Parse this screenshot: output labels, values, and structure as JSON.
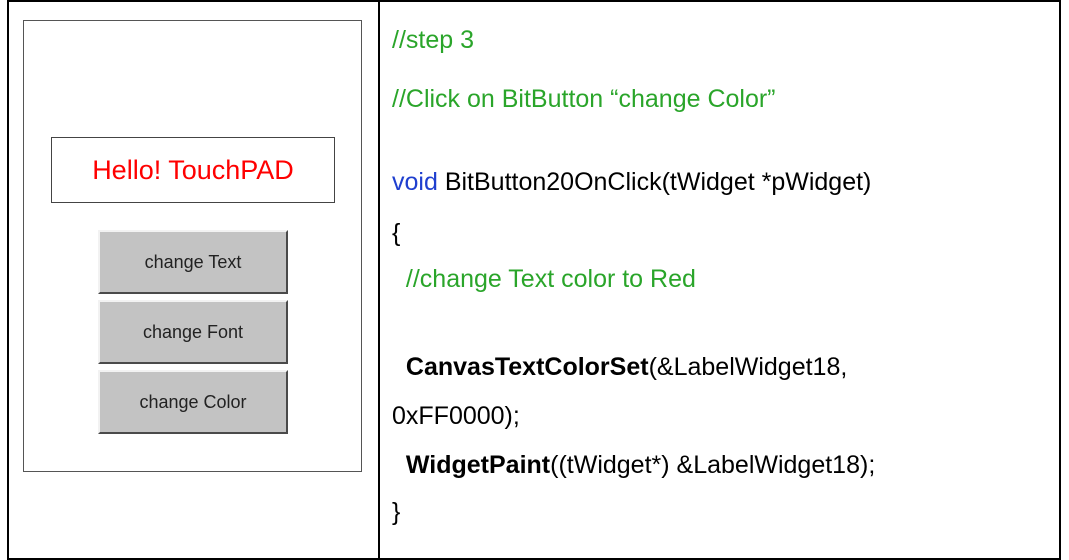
{
  "preview": {
    "label_text": "Hello! TouchPAD",
    "label_color": "#ff0000",
    "buttons": [
      {
        "label": "change Text"
      },
      {
        "label": "change Font"
      },
      {
        "label": "change Color"
      }
    ]
  },
  "code": {
    "line1": "//step 3",
    "line2": "//Click on BitButton “change Color”",
    "line3_keyword": "void",
    "line3_rest": " BitButton20OnClick(tWidget *pWidget)",
    "line4": "{",
    "line5_indent": "  ",
    "line5_comment": "//change Text color to Red",
    "line6_indent": "  ",
    "line6_func": "CanvasTextColorSet",
    "line6_rest": "(&LabelWidget18,",
    "line7": "0xFF0000);",
    "line8_indent": "  ",
    "line8_func": "WidgetPaint",
    "line8_rest": "((tWidget*) &LabelWidget18);",
    "line9": "}"
  },
  "colors": {
    "comment": "#2aa52a",
    "keyword": "#1f3fcf",
    "button_face": "#c3c3c3"
  }
}
